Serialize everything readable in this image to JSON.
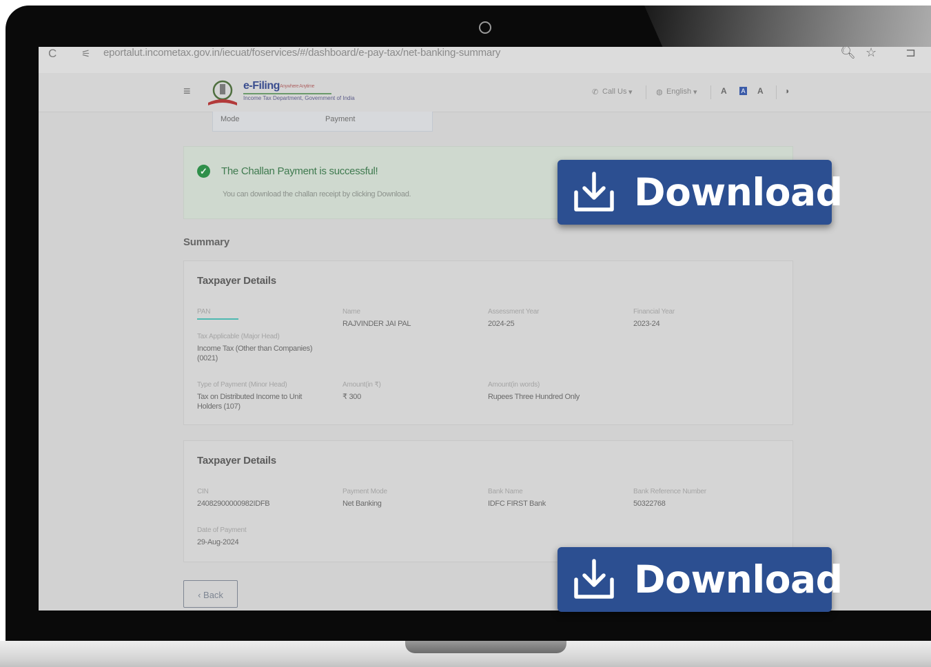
{
  "browser": {
    "url": "eportalut.incometax.gov.in/iecuat/foservices/#/dashboard/e-pay-tax/net-banking-summary",
    "reload_glyph": "C"
  },
  "header": {
    "logo_text": "e-Filing",
    "logo_tagline": "Anywhere Anytime",
    "logo_sub": "Income Tax Department, Government of India",
    "call_us": "Call Us",
    "language": "English"
  },
  "mode_table": {
    "col1": "Mode",
    "col2": "Payment"
  },
  "success": {
    "title": "The Challan Payment is successful!",
    "subtitle": "You can download the challan receipt by clicking Download."
  },
  "summary": {
    "title": "Summary",
    "card1": {
      "title": "Taxpayer Details",
      "fields": {
        "pan_label": "PAN",
        "name_label": "Name",
        "name_value": "RAJVINDER JAI PAL",
        "ay_label": "Assessment Year",
        "ay_value": "2024-25",
        "fy_label": "Financial Year",
        "fy_value": "2023-24",
        "tax_label": "Tax Applicable (Major Head)",
        "tax_value": "Income Tax (Other than Companies) (0021)",
        "type_label": "Type of Payment (Minor Head)",
        "type_value": "Tax on Distributed Income to Unit Holders (107)",
        "amount_label": "Amount(in ₹)",
        "amount_value": "₹ 300",
        "words_label": "Amount(in words)",
        "words_value": "Rupees Three Hundred Only"
      }
    },
    "card2": {
      "title": "Taxpayer Details",
      "fields": {
        "cin_label": "CIN",
        "cin_value": "24082900000982IDFB",
        "mode_label": "Payment Mode",
        "mode_value": "Net Banking",
        "bank_label": "Bank Name",
        "bank_value": "IDFC FIRST Bank",
        "ref_label": "Bank Reference Number",
        "ref_value": "50322768",
        "date_label": "Date of Payment",
        "date_value": "29-Aug-2024"
      }
    }
  },
  "back_button": "‹ Back",
  "download_overlay": {
    "label": "Download",
    "color": "#2c4f91"
  }
}
